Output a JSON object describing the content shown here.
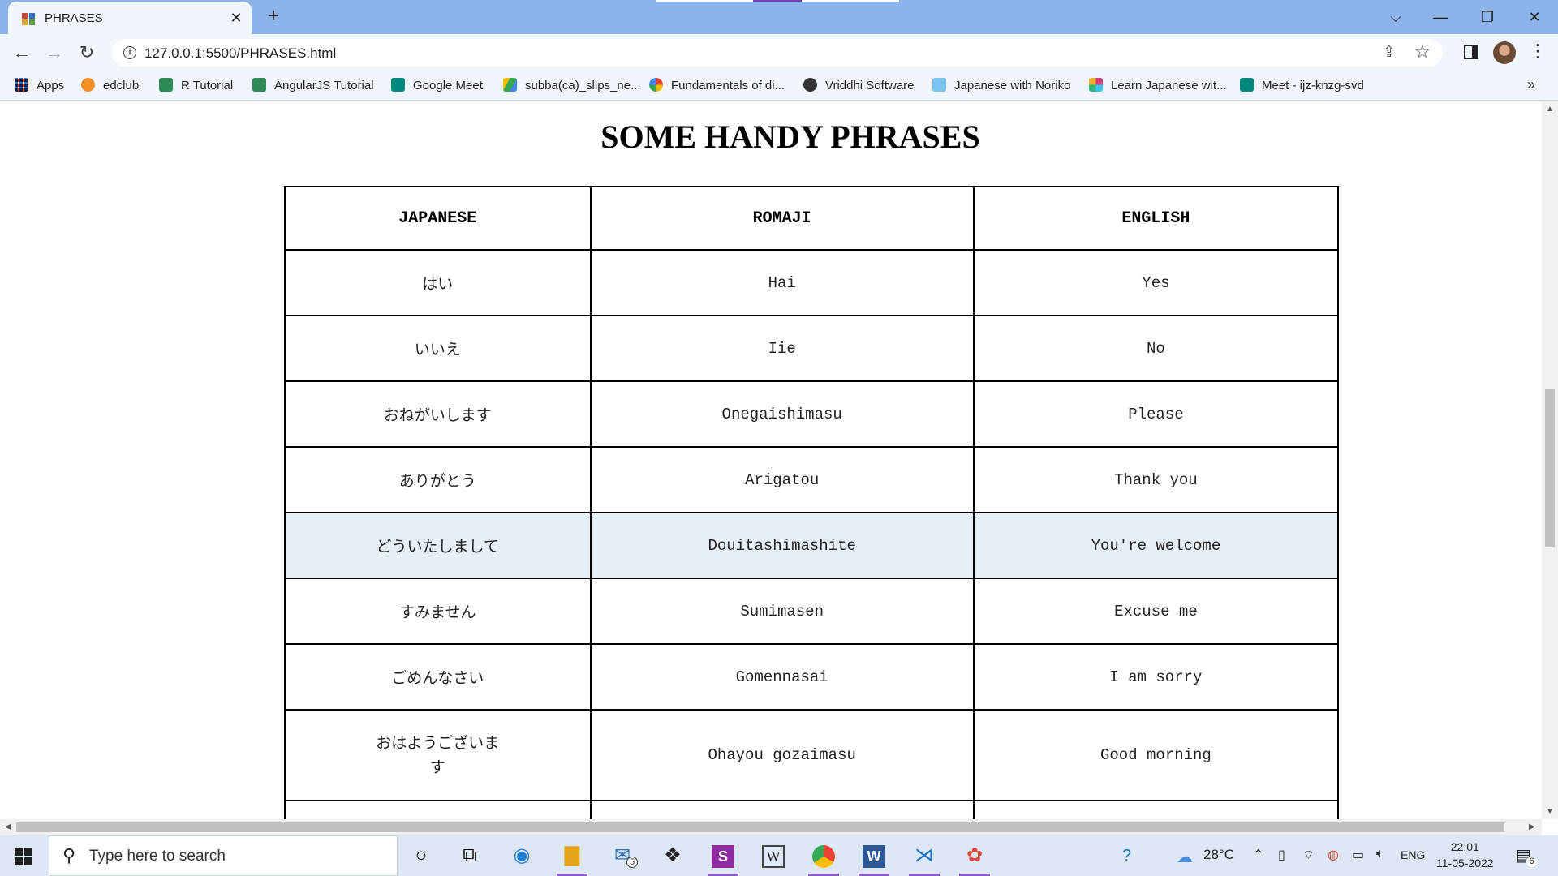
{
  "browser": {
    "tab_title": "PHRASES",
    "tab_close": "✕",
    "new_tab": "+",
    "url": "127.0.0.1:5500/PHRASES.html",
    "window_controls": [
      "⌵",
      "—",
      "❐",
      "✕"
    ]
  },
  "bookmarks": [
    {
      "label": "Apps",
      "icon": "apps-grid-icon",
      "color": "#1a73e8"
    },
    {
      "label": "edclub",
      "icon": "edclub-icon",
      "color": "#f29025"
    },
    {
      "label": "R Tutorial",
      "icon": "w3-icon",
      "color": "#2e8b57"
    },
    {
      "label": "AngularJS Tutorial",
      "icon": "w3-icon",
      "color": "#2e8b57"
    },
    {
      "label": "Google Meet",
      "icon": "meet-icon",
      "color": "#00897b"
    },
    {
      "label": "subba(ca)_slips_ne...",
      "icon": "drive-icon",
      "color": "#fbbc04"
    },
    {
      "label": "Fundamentals of di...",
      "icon": "google-icon",
      "color": "#4285f4"
    },
    {
      "label": "Vriddhi Software",
      "icon": "globe-icon",
      "color": "#333333"
    },
    {
      "label": "Japanese with Noriko",
      "icon": "noriko-icon",
      "color": "#7cc4f0"
    },
    {
      "label": "Learn Japanese wit...",
      "icon": "slack-icon",
      "color": "#d13b7c"
    },
    {
      "label": "Meet - ijz-knzg-svd",
      "icon": "meet-icon",
      "color": "#00897b"
    }
  ],
  "page": {
    "heading": "SOME HANDY PHRASES",
    "table": {
      "headers": [
        "JAPANESE",
        "ROMAJI",
        "ENGLISH"
      ],
      "rows": [
        {
          "jp": "はい",
          "romaji": "Hai",
          "en": "Yes"
        },
        {
          "jp": "いいえ",
          "romaji": "Iie",
          "en": "No"
        },
        {
          "jp": "おねがいします",
          "romaji": "Onegaishimasu",
          "en": "Please"
        },
        {
          "jp": "ありがとう",
          "romaji": "Arigatou",
          "en": "Thank you"
        },
        {
          "jp": "どういたしまして",
          "romaji": "Douitashimashite",
          "en": "You're welcome"
        },
        {
          "jp": "すみません",
          "romaji": "Sumimasen",
          "en": "Excuse me"
        },
        {
          "jp": "ごめんなさい",
          "romaji": "Gomennasai",
          "en": "I am sorry"
        },
        {
          "jp": "おはようございます",
          "romaji": "Ohayou gozaimasu",
          "en": "Good morning"
        }
      ]
    }
  },
  "taskbar": {
    "search_placeholder": "Type here to search",
    "mail_badge": "5",
    "temperature": "28°C",
    "language": "ENG",
    "time": "22:01",
    "date": "11-05-2022",
    "notification_count": "6"
  }
}
